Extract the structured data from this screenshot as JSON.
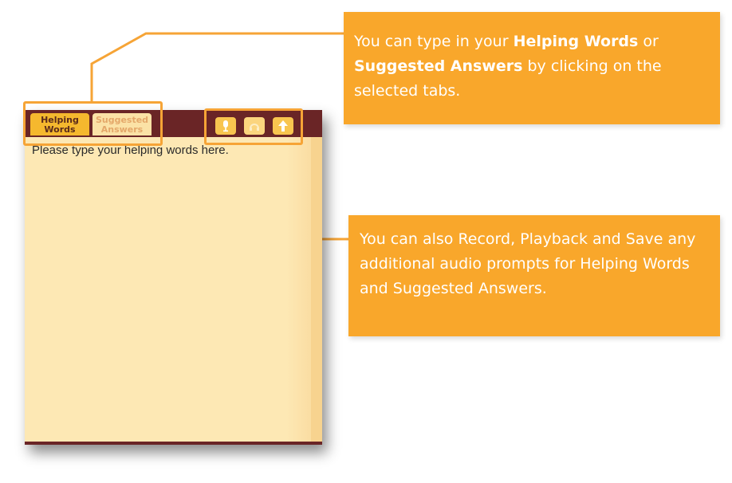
{
  "panel": {
    "tabs": [
      {
        "line1": "Helping",
        "line2": "Words"
      },
      {
        "line1": "Suggested",
        "line2": "Answers"
      }
    ],
    "tools": [
      {
        "name": "record-icon"
      },
      {
        "name": "playback-icon"
      },
      {
        "name": "save-icon"
      }
    ],
    "placeholder": "Please type your helping words here."
  },
  "callouts": {
    "tabs": {
      "part1": "You can type in your ",
      "bold1": "Helping Words",
      "part2": " or ",
      "bold2": "Suggested Answers",
      "part3": " by clicking on the selected tabs."
    },
    "audio": {
      "text": "You can also Record, Playback and Save any additional audio prompts for Helping Words and Suggested Answers."
    }
  },
  "colors": {
    "accent": "#f9a72b",
    "header": "#6a2526",
    "panel_bg": "#fde8b4"
  }
}
